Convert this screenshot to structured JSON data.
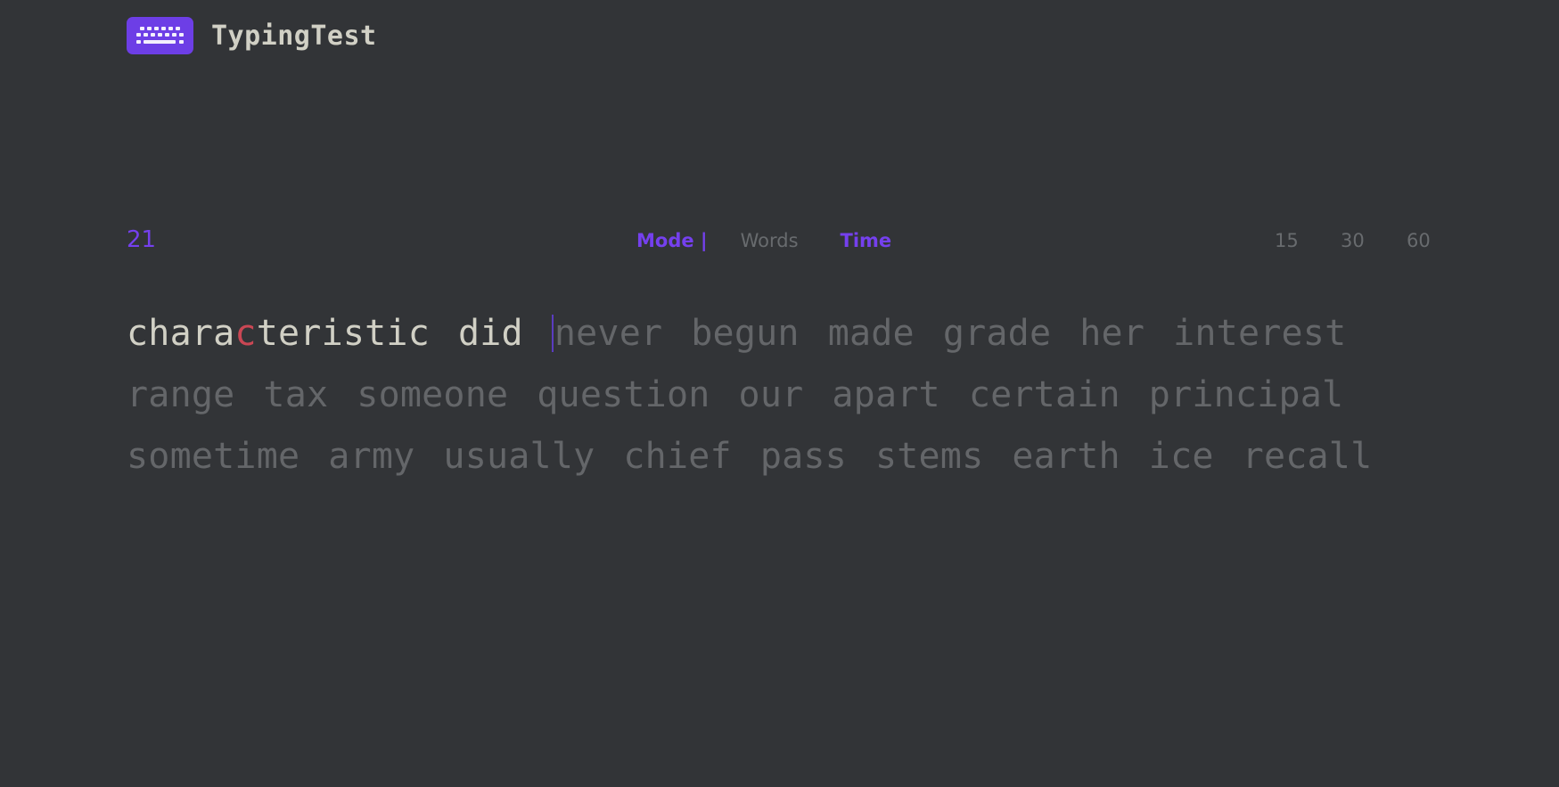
{
  "app": {
    "title": "TypingTest",
    "logo_icon": "keyboard-icon",
    "accent": "#6d3ee6"
  },
  "timer": {
    "value": "21"
  },
  "mode": {
    "label": "Mode |",
    "options": [
      "Words",
      "Time"
    ],
    "selected": "Time"
  },
  "durations": {
    "options": [
      "15",
      "30",
      "60"
    ]
  },
  "test": {
    "typed_words": [
      {
        "prefix": "chara",
        "error": "c",
        "suffix": "teristic"
      },
      {
        "prefix": "did",
        "error": "",
        "suffix": ""
      }
    ],
    "lines": [
      [
        "never",
        "begun",
        "made",
        "grade",
        "her",
        "interest"
      ],
      [
        "range",
        "tax",
        "someone",
        "question",
        "our",
        "apart",
        "certain",
        "principal"
      ],
      [
        "sometime",
        "army",
        "usually",
        "chief",
        "pass",
        "stems",
        "earth",
        "ice",
        "recall"
      ]
    ],
    "colors": {
      "typed": "#d1d0c5",
      "error": "#ca4754",
      "untyped": "#646669",
      "caret": "#5a3cc0"
    }
  }
}
